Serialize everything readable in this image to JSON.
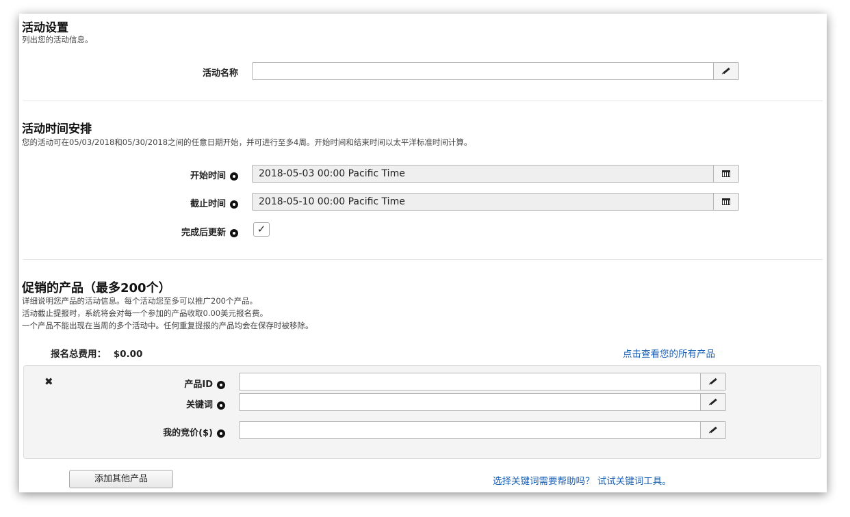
{
  "settings": {
    "title": "活动设置",
    "subtitle": "列出您的活动信息。",
    "name_label": "活动名称",
    "name_value": ""
  },
  "schedule": {
    "title": "活动时间安排",
    "description": "您的活动可在05/03/2018和05/30/2018之间的任意日期开始，并可进行至多4周。开始时间和结束时间以太平洋标准时间计算。",
    "start_label": "开始时间",
    "start_value": "2018-05-03 00:00 Pacific Time",
    "end_label": "截止时间",
    "end_value": "2018-05-10 00:00 Pacific Time",
    "renew_label": "完成后更新",
    "renew_checked": "✓"
  },
  "products": {
    "title": "促销的产品（最多200个）",
    "desc_lines": [
      "详细说明您产品的活动信息。每个活动您至多可以推广200个产品。",
      "活动截止提报时，系统将会对每一个参加的产品收取0.00美元报名费。",
      "一个产品不能出现在当周的多个活动中。任何重复提报的产品均会在保存时被移除。"
    ],
    "fee_label": "报名总费用：",
    "fee_value": "$0.00",
    "view_all_link": "点击查看您的所有产品",
    "remove_icon": "✖",
    "product_id_label": "产品ID",
    "keyword_label": "关键词",
    "bid_label": "我的竞价($)",
    "add_button": "添加其他产品",
    "help_link": "选择关键词需要帮助吗？ 试试关键词工具。"
  },
  "icons": {
    "info": "eye-icon",
    "edit": "pencil-icon",
    "calendar": "calendar-icon",
    "remove": "close-icon"
  },
  "colors": {
    "link": "#1a5fb4",
    "panel": "#f4f4f4"
  }
}
